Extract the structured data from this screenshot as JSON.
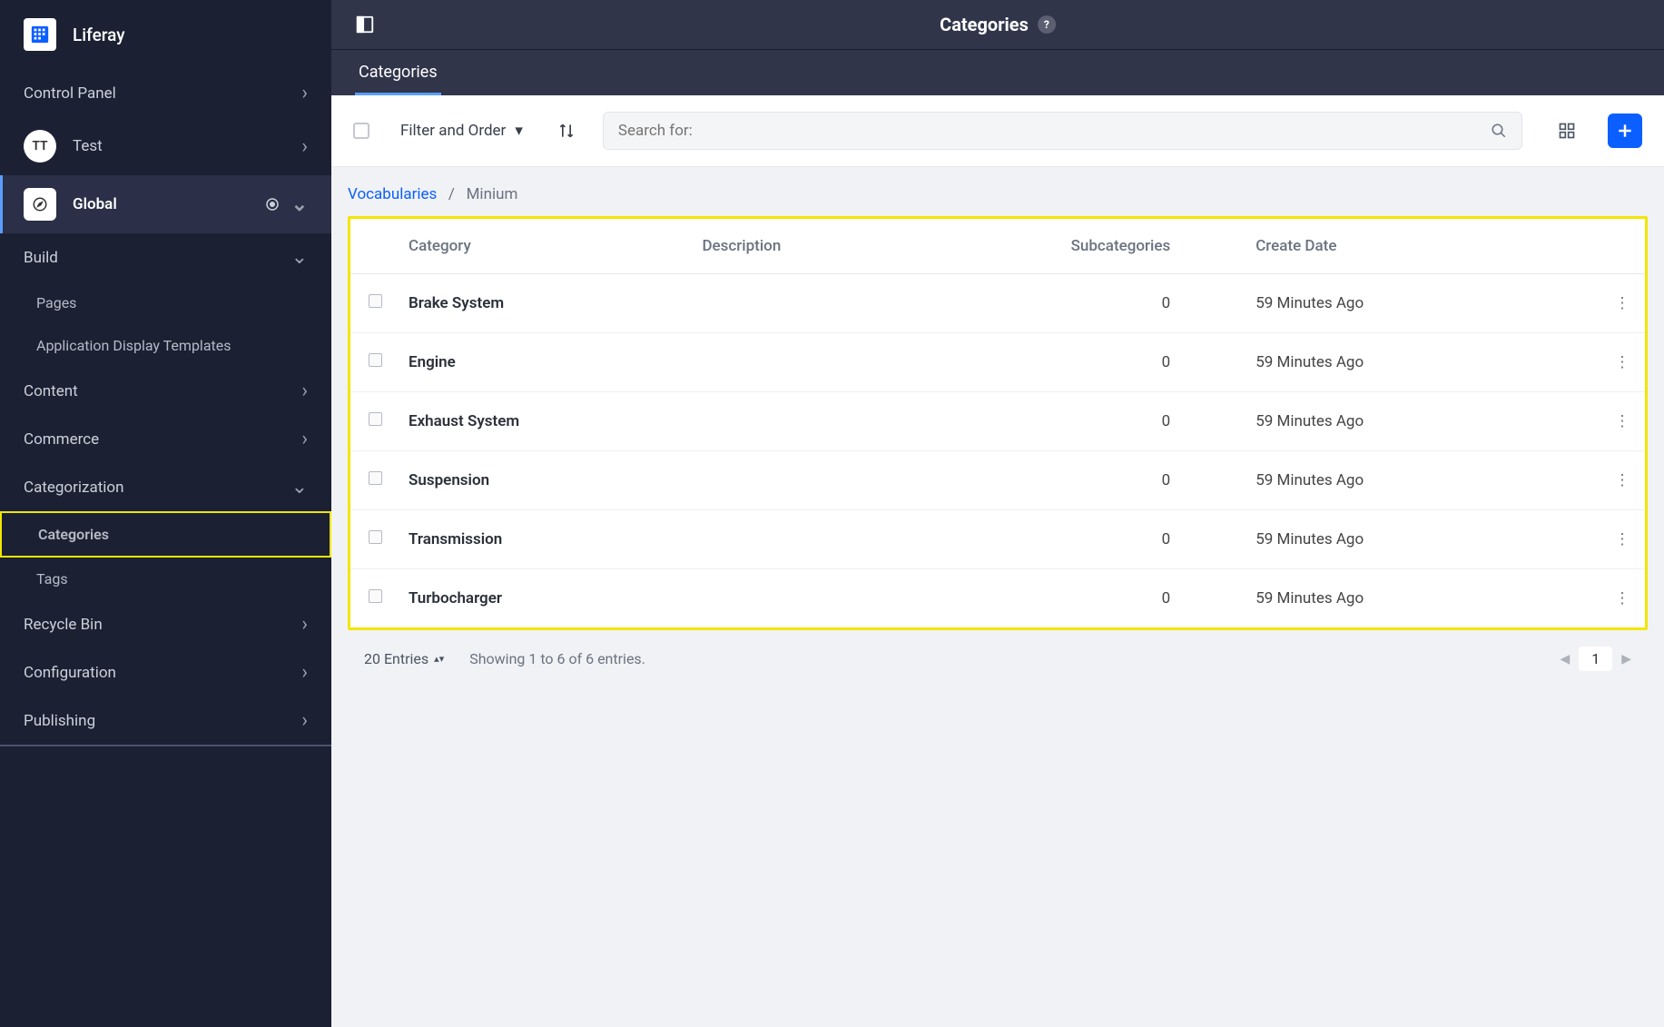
{
  "brand": {
    "name": "Liferay"
  },
  "sidebar": {
    "control_panel": "Control Panel",
    "user": {
      "initials": "TT",
      "name": "Test"
    },
    "site": {
      "name": "Global"
    },
    "build": {
      "label": "Build",
      "items": [
        "Pages",
        "Application Display Templates"
      ]
    },
    "content": "Content",
    "commerce": "Commerce",
    "categorization": {
      "label": "Categorization",
      "items": [
        "Categories",
        "Tags"
      ]
    },
    "recycle_bin": "Recycle Bin",
    "configuration": "Configuration",
    "publishing": "Publishing"
  },
  "header": {
    "title": "Categories",
    "tab": "Categories"
  },
  "toolbar": {
    "filter": "Filter and Order",
    "search_placeholder": "Search for:"
  },
  "breadcrumb": {
    "root": "Vocabularies",
    "current": "Minium"
  },
  "table": {
    "columns": {
      "category": "Category",
      "description": "Description",
      "subcategories": "Subcategories",
      "create_date": "Create Date"
    },
    "rows": [
      {
        "category": "Brake System",
        "description": "",
        "subcategories": 0,
        "create_date": "59 Minutes Ago"
      },
      {
        "category": "Engine",
        "description": "",
        "subcategories": 0,
        "create_date": "59 Minutes Ago"
      },
      {
        "category": "Exhaust System",
        "description": "",
        "subcategories": 0,
        "create_date": "59 Minutes Ago"
      },
      {
        "category": "Suspension",
        "description": "",
        "subcategories": 0,
        "create_date": "59 Minutes Ago"
      },
      {
        "category": "Transmission",
        "description": "",
        "subcategories": 0,
        "create_date": "59 Minutes Ago"
      },
      {
        "category": "Turbocharger",
        "description": "",
        "subcategories": 0,
        "create_date": "59 Minutes Ago"
      }
    ]
  },
  "footer": {
    "entries": "20 Entries",
    "showing": "Showing 1 to 6 of 6 entries.",
    "page": "1"
  }
}
